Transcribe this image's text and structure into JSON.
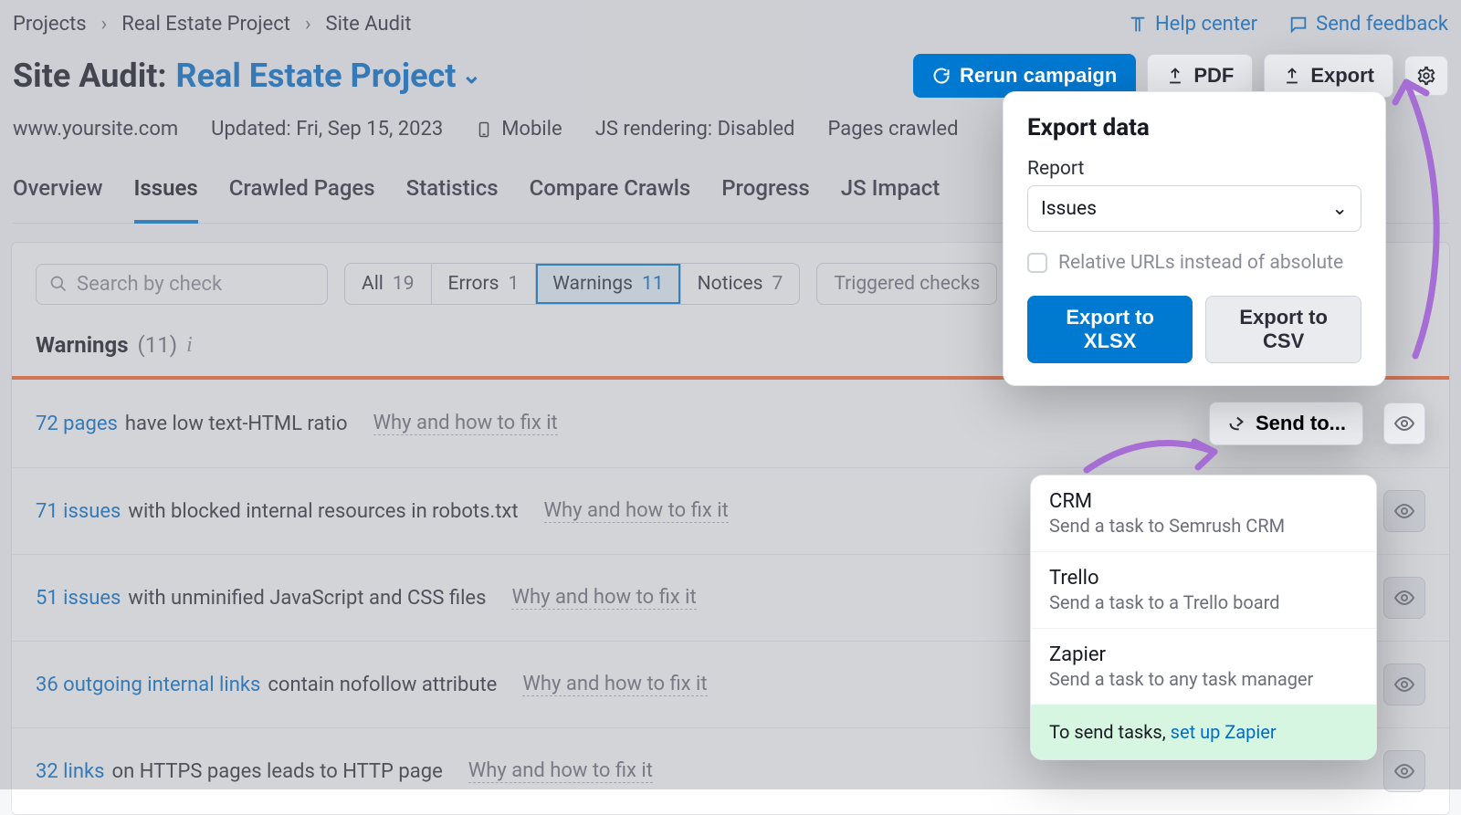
{
  "breadcrumbs": [
    "Projects",
    "Real Estate Project",
    "Site Audit"
  ],
  "topLinks": {
    "help": "Help center",
    "feedback": "Send feedback"
  },
  "title": {
    "prefix": "Site Audit:",
    "project": "Real Estate Project"
  },
  "actions": {
    "rerun": "Rerun campaign",
    "pdf": "PDF",
    "export": "Export"
  },
  "meta": {
    "site": "www.yoursite.com",
    "updated": "Updated: Fri, Sep 15, 2023",
    "device": "Mobile",
    "js": "JS rendering: Disabled",
    "crawled": "Pages crawled"
  },
  "tabs": [
    "Overview",
    "Issues",
    "Crawled Pages",
    "Statistics",
    "Compare Crawls",
    "Progress",
    "JS Impact"
  ],
  "activeTab": "Issues",
  "search": {
    "placeholder": "Search by check"
  },
  "filters": {
    "all": {
      "label": "All",
      "count": "19"
    },
    "errors": {
      "label": "Errors",
      "count": "1"
    },
    "warnings": {
      "label": "Warnings",
      "count": "11"
    },
    "notices": {
      "label": "Notices",
      "count": "7"
    }
  },
  "triggered": "Triggered checks",
  "section": {
    "label": "Warnings",
    "count": "(11)"
  },
  "whyFix": "Why and how to fix it",
  "issues": [
    {
      "link": "72 pages",
      "rest": " have low text-HTML ratio"
    },
    {
      "link": "71 issues",
      "rest": " with blocked internal resources in robots.txt"
    },
    {
      "link": "51 issues",
      "rest": " with unminified JavaScript and CSS files"
    },
    {
      "link": "36 outgoing internal links",
      "rest": " contain nofollow attribute"
    },
    {
      "link": "32 links",
      "rest": " on HTTPS pages leads to HTTP page"
    }
  ],
  "exportPopup": {
    "title": "Export data",
    "reportLabel": "Report",
    "reportValue": "Issues",
    "relativeUrls": "Relative URLs instead of absolute",
    "xlsx": "Export to XLSX",
    "csv": "Export to CSV"
  },
  "sendTo": {
    "button": "Send to..."
  },
  "sendToPopup": {
    "options": [
      {
        "t": "CRM",
        "d": "Send a task to Semrush CRM"
      },
      {
        "t": "Trello",
        "d": "Send a task to a Trello board"
      },
      {
        "t": "Zapier",
        "d": "Send a task to any task manager"
      }
    ],
    "footerText": "To send tasks, ",
    "footerLink": "set up Zapier"
  }
}
